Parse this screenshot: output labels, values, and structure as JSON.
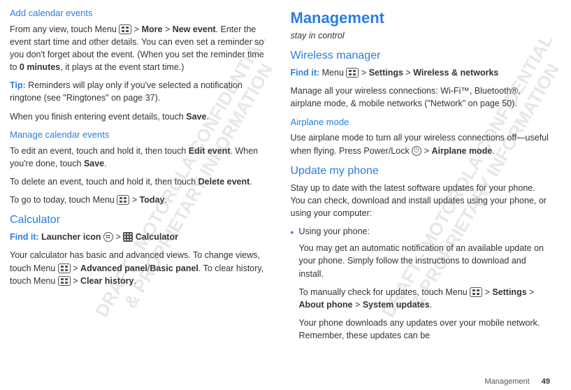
{
  "watermark": "DRAFT - MOTOROLA CONFIDENTIAL\n& PROPRIETARY INFORMATION",
  "left": {
    "h_add": "Add calendar events",
    "p_add": "From any view, touch Menu ",
    "p_add2": " > ",
    "more": "More",
    "gt": " > ",
    "newevent": "New event",
    "p_add3": ". Enter the event start time and other details. You can even set a reminder so you don't forget about the event. (When you set the reminder time to ",
    "zeromin": "0 minutes",
    "p_add4": ", it plays at the event start time.)",
    "tip_label": "Tip:",
    "tip_body": " Reminders will play only if you've selected a notification ringtone (see \"Ringtones\" on page 37).",
    "p_finish": "When you finish entering event details, touch ",
    "save": "Save",
    "h_manage": "Manage calendar events",
    "p_edit": "To edit an event, touch and hold it, then touch ",
    "editevent": "Edit event",
    "p_edit2": ". When you're done, touch ",
    "p_delete": "To delete an event, touch and hold it, then touch ",
    "deleteevent": "Delete event",
    "p_today": "To go to today, touch Menu ",
    "today": "Today",
    "h_calc": "Calculator",
    "findit": "Find it:",
    "launchericon": "Launcher icon",
    "calculator": "Calculator",
    "p_calc": "Your calculator has basic and advanced views. To change views, touch Menu ",
    "advpanel": "Advanced panel",
    "slash": "/",
    "basicpanel": "Basic panel",
    "p_calc2": ". To clear history, touch Menu ",
    "clearhist": "Clear history"
  },
  "right": {
    "h_main": "Management",
    "sub": "stay in control",
    "h_wm": "Wireless manager",
    "findit": "Find it:",
    "menu": " Menu ",
    "settings": "Settings",
    "wnet": "Wireless & networks",
    "p_wm": "Manage all your wireless connections: Wi-Fi™, Bluetooth®, airplane mode, & mobile networks (\"Network\" on page 50).",
    "h_air": "Airplane mode",
    "p_air": "Use airplane mode to turn all your wireless connections off—useful when flying. Press Power/Lock ",
    "airplane": "Airplane mode",
    "h_update": "Update my phone",
    "p_update": "Stay up to date with the latest software updates for your phone. You can check, download and install updates using your phone, or using your computer:",
    "bullet1": "Using your phone:",
    "b1a": "You may get an automatic notification of an available update on your phone. Simply follow the instructions to download and install.",
    "b1b_pre": "To manually check for updates, touch Menu ",
    "about": "About phone",
    "sysup": "System updates",
    "b1c": "Your phone downloads any updates over your mobile network. Remember, these updates can be"
  },
  "footer": {
    "label": "Management",
    "page": "49"
  }
}
